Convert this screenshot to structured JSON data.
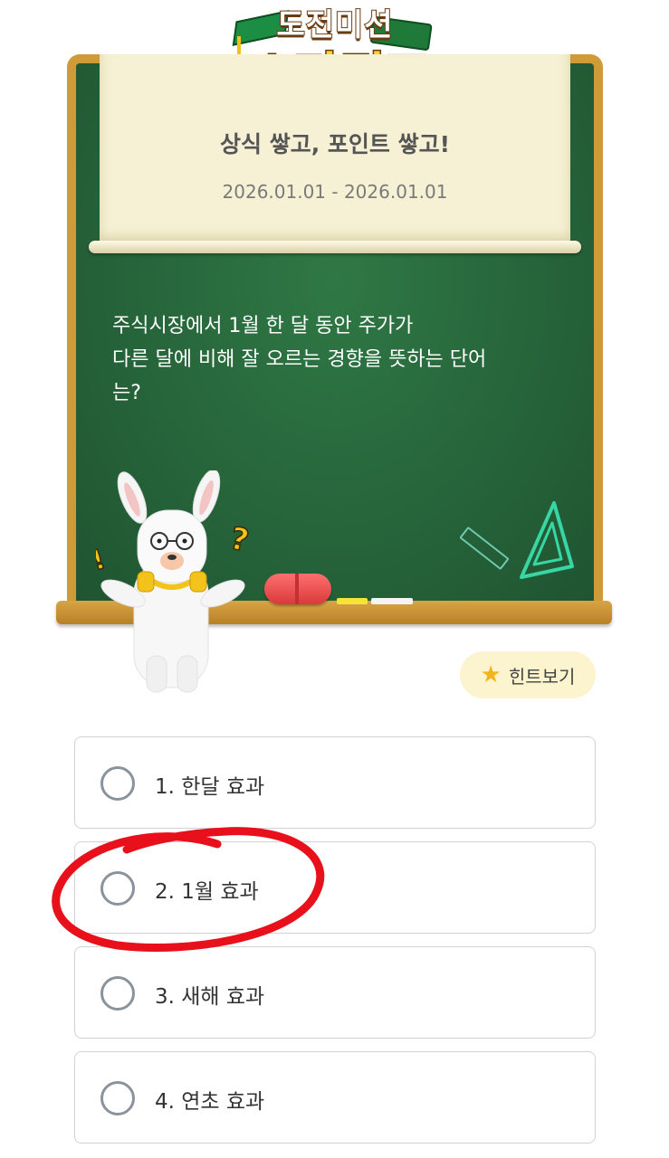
{
  "logo": {
    "top_text": "도전미션",
    "main_text": "스타퀴즈"
  },
  "quiz": {
    "title": "상식 쌓고, 포인트 쌓고!",
    "date_range": "2026.01.01 - 2026.01.01",
    "question": "주식시장에서 1월 한 달 동안 주가가\n다른 달에 비해 잘 오르는 경향을 뜻하는 단어\n는?"
  },
  "hint": {
    "label": "힌트보기",
    "icon": "star-icon"
  },
  "options": [
    {
      "label": "1. 한달 효과"
    },
    {
      "label": "2. 1월 효과"
    },
    {
      "label": "3. 새해 효과"
    },
    {
      "label": "4. 연초 효과"
    }
  ],
  "colors": {
    "board": "#2f6b3f",
    "frame": "#cf9a38",
    "paper": "#f6f1d4",
    "annotation": "#e8101a"
  }
}
